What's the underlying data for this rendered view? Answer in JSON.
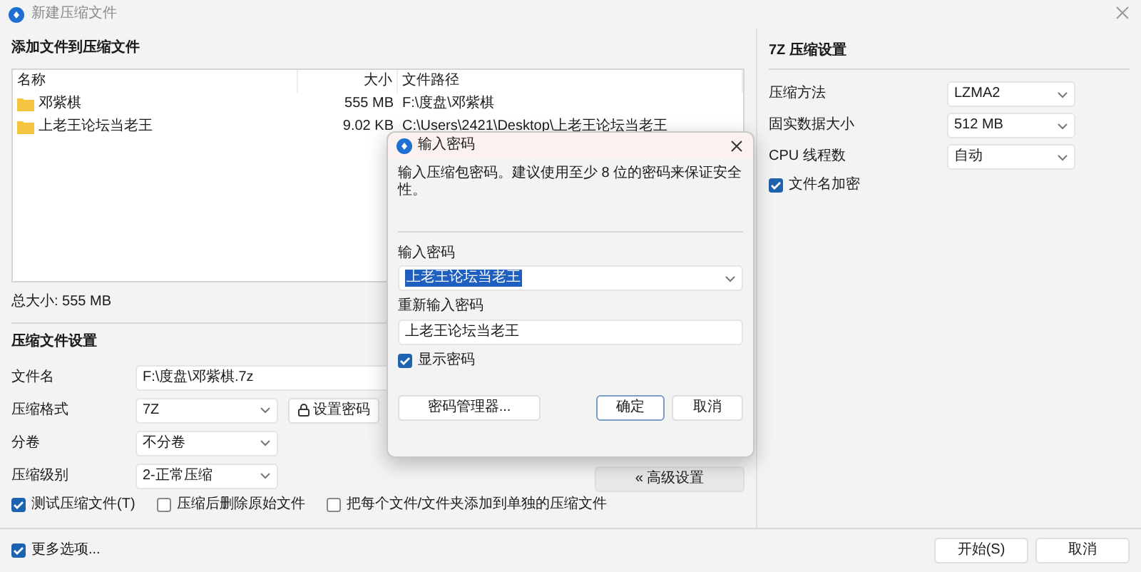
{
  "window": {
    "title": "新建压缩文件"
  },
  "files": {
    "heading": "添加文件到压缩文件",
    "columns": [
      "名称",
      "大小",
      "文件路径"
    ],
    "rows": [
      {
        "name": "邓紫棋",
        "size": "555 MB",
        "path": "F:\\度盘\\邓紫棋"
      },
      {
        "name": "上老王论坛当老王",
        "size": "9.02 KB",
        "path": "C:\\Users\\2421\\Desktop\\上老王论坛当老王"
      }
    ]
  },
  "total": "总大小: 555 MB",
  "settings": {
    "heading": "压缩文件设置",
    "fields": [
      {
        "kind": "input",
        "label": "文件名",
        "value": "F:\\度盘\\邓紫棋.7z"
      },
      {
        "kind": "select",
        "label": "压缩格式",
        "value": "7Z",
        "button": {
          "kind": "password",
          "label": "设置密码"
        }
      },
      {
        "kind": "select",
        "label": "分卷",
        "value": "不分卷"
      },
      {
        "kind": "select",
        "label": "压缩级别",
        "value": "2-正常压缩",
        "button": {
          "kind": "advanced",
          "label": "« 高级设置"
        }
      }
    ],
    "checkboxes": [
      {
        "label": "测试压缩文件(T)",
        "checked": true
      },
      {
        "label": "压缩后删除原始文件",
        "checked": false
      },
      {
        "label": "把每个文件/文件夹添加到单独的压缩文件",
        "checked": false
      }
    ]
  },
  "method": {
    "heading": "7Z 压缩设置",
    "fields": [
      {
        "label": "压缩方法",
        "value": "LZMA2"
      },
      {
        "label": "固实数据大小",
        "value": "512 MB"
      },
      {
        "label": "CPU 线程数",
        "value": "自动"
      }
    ],
    "checkboxes": [
      {
        "label": "文件名加密",
        "checked": true
      }
    ]
  },
  "more_options": {
    "label": "更多选项...",
    "checked": true
  },
  "buttons": [
    {
      "label": "开始(S)"
    },
    {
      "label": "取消"
    }
  ],
  "dialog": {
    "title": "输入密码",
    "message": "输入压缩包密码。建议使用至少 8 位的密码来保证安全性。",
    "password": {
      "label": "输入密码",
      "value": "上老王论坛当老王",
      "selected": true
    },
    "confirm": {
      "label": "重新输入密码",
      "value": "上老王论坛当老王"
    },
    "show_password": {
      "label": "显示密码",
      "checked": true
    },
    "buttons": [
      {
        "label": "密码管理器...",
        "kind": "wide"
      },
      {
        "label": "确定",
        "kind": "default"
      },
      {
        "label": "取消",
        "kind": "normal"
      }
    ]
  }
}
